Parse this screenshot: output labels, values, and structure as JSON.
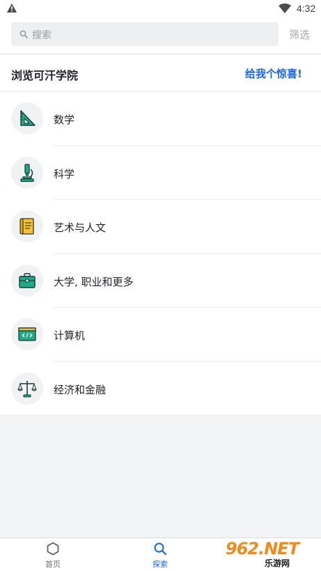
{
  "status_bar": {
    "time": "4:32",
    "icons": [
      "warning-icon",
      "wifi-icon"
    ]
  },
  "search": {
    "placeholder": "搜索",
    "filter_label": "筛选"
  },
  "header": {
    "title": "浏览可汗学院",
    "surprise_label": "给我个惊喜!"
  },
  "subjects": [
    {
      "label": "数学",
      "icon": "triangle-ruler-icon"
    },
    {
      "label": "科学",
      "icon": "microscope-icon"
    },
    {
      "label": "艺术与人文",
      "icon": "scroll-icon"
    },
    {
      "label": "大学, 职业和更多",
      "icon": "briefcase-icon"
    },
    {
      "label": "计算机",
      "icon": "code-screen-icon"
    },
    {
      "label": "经济和金融",
      "icon": "balance-scale-icon"
    }
  ],
  "bottom_nav": {
    "tabs": [
      {
        "label": "首页",
        "icon": "hexagon-icon",
        "active": false
      },
      {
        "label": "探索",
        "icon": "search-icon",
        "active": true
      }
    ]
  },
  "watermark": {
    "main": "962.NET",
    "sub": "乐游网"
  },
  "colors": {
    "accent": "#1865f2",
    "icon_teal": "#1fab8a",
    "icon_yellow": "#f4c430"
  }
}
